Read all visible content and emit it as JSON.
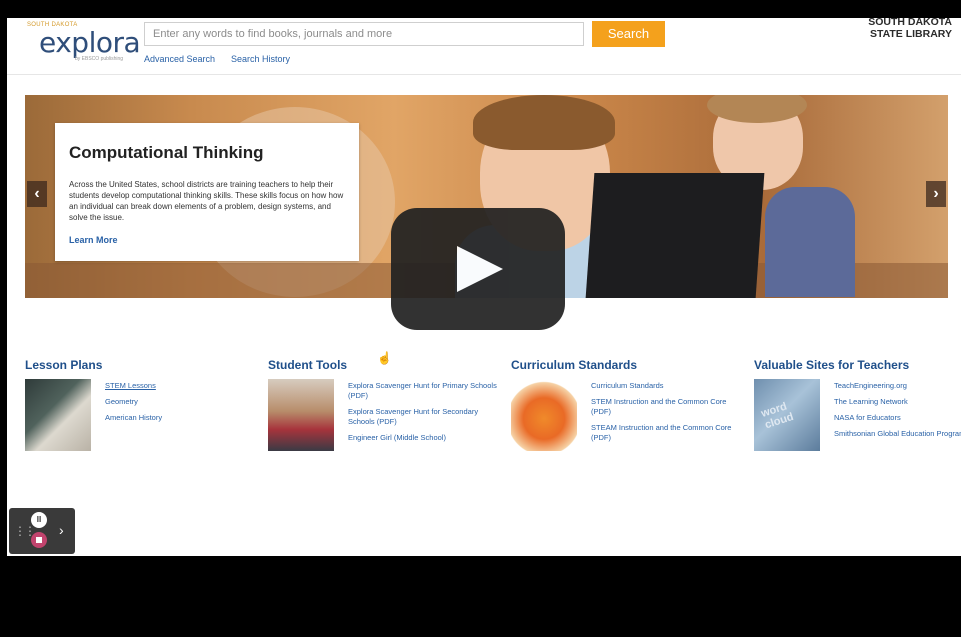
{
  "header": {
    "logo_tag": "SOUTH DAKOTA",
    "logo_word": "explora",
    "logo_sub": "by EBSCO publishing",
    "search_placeholder": "Enter any words to find books, journals and more",
    "search_button": "Search",
    "advanced_search": "Advanced Search",
    "search_history": "Search History",
    "library_line1": "SOUTH DAKOTA",
    "library_line2": "STATE LIBRARY"
  },
  "hero": {
    "title": "Computational Thinking",
    "body": "Across the United States, school districts are training teachers to help their students develop computational thinking skills. These skills focus on how how an individual can break down elements of a problem, design systems, and solve the issue.",
    "link": "Learn More",
    "prev": "‹",
    "next": "›"
  },
  "columns": [
    {
      "title": "Lesson Plans",
      "links": [
        "STEM Lessons",
        "Geometry",
        "American History"
      ]
    },
    {
      "title": "Student Tools",
      "links": [
        "Explora Scavenger Hunt for Primary Schools (PDF)",
        "Explora Scavenger Hunt for Secondary Schools (PDF)",
        "Engineer Girl (Middle School)"
      ]
    },
    {
      "title": "Curriculum Standards",
      "links": [
        "Curriculum Standards",
        "STEM Instruction and the Common Core (PDF)",
        "STEAM Instruction and the Common Core (PDF)"
      ]
    },
    {
      "title": "Valuable Sites for Teachers",
      "thumb_text": "word cloud",
      "links": [
        "TeachEngineering.org",
        "The Learning Network",
        "NASA for Educators",
        "Smithsonian Global Education Program"
      ]
    }
  ],
  "video": {
    "play_icon": "play-icon"
  },
  "widget": {
    "pause_glyph": "II",
    "chevron": "›",
    "grip": "⋮⋮"
  },
  "colors": {
    "accent": "#f4a11c",
    "link": "#2a62a7",
    "heading": "#1f4f8a"
  }
}
